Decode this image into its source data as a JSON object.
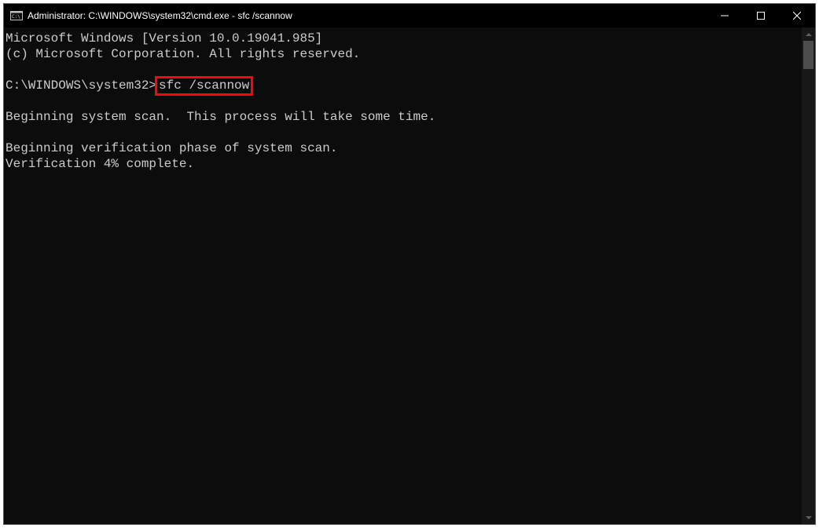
{
  "window": {
    "title": "Administrator: C:\\WINDOWS\\system32\\cmd.exe - sfc  /scannow"
  },
  "terminal": {
    "line1": "Microsoft Windows [Version 10.0.19041.985]",
    "line2": "(c) Microsoft Corporation. All rights reserved.",
    "blank1": "",
    "prompt": "C:\\WINDOWS\\system32>",
    "command": "sfc /scannow",
    "blank2": "",
    "line3": "Beginning system scan.  This process will take some time.",
    "blank3": "",
    "line4": "Beginning verification phase of system scan.",
    "line5": "Verification 4% complete."
  },
  "highlight_color": "#ff0018"
}
